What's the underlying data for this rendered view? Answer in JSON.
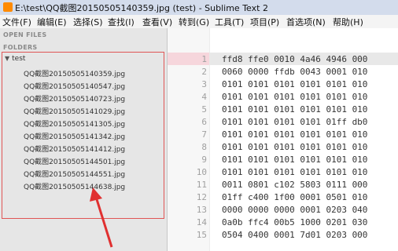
{
  "window": {
    "title": "E:\\test\\QQ截图20150505140359.jpg (test) - Sublime Text 2"
  },
  "menu": [
    "文件(F)",
    "编辑(E)",
    "选择(S)",
    "查找(I)",
    "查看(V)",
    "转到(G)",
    "工具(T)",
    "项目(P)",
    "首选项(N)",
    "帮助(H)"
  ],
  "sidebar": {
    "open_files_label": "OPEN FILES",
    "folders_label": "FOLDERS",
    "folder_name": "test",
    "files": [
      "QQ截图20150505140359.jpg",
      "QQ截图20150505140547.jpg",
      "QQ截图20150505140723.jpg",
      "QQ截图20150505141029.jpg",
      "QQ截图20150505141305.jpg",
      "QQ截图20150505141342.jpg",
      "QQ截图20150505141412.jpg",
      "QQ截图20150505144501.jpg",
      "QQ截图20150505144551.jpg",
      "QQ截图20150505144638.jpg"
    ]
  },
  "editor": {
    "line_numbers": [
      "1",
      "2",
      "3",
      "4",
      "5",
      "6",
      "7",
      "8",
      "9",
      "10",
      "11",
      "12",
      "13",
      "14",
      "15"
    ],
    "lines": [
      "ffd8 ffe0 0010 4a46 4946 000",
      "0060 0000 ffdb 0043 0001 010",
      "0101 0101 0101 0101 0101 010",
      "0101 0101 0101 0101 0101 010",
      "0101 0101 0101 0101 0101 010",
      "0101 0101 0101 0101 01ff db0",
      "0101 0101 0101 0101 0101 010",
      "0101 0101 0101 0101 0101 010",
      "0101 0101 0101 0101 0101 010",
      "0101 0101 0101 0101 0101 010",
      "0011 0801 c102 5803 0111 000",
      "01ff c400 1f00 0001 0501 010",
      "0000 0000 0000 0001 0203 040",
      "0a0b ffc4 00b5 1000 0201 030",
      "0504 0400 0001 7d01 0203 000"
    ]
  }
}
